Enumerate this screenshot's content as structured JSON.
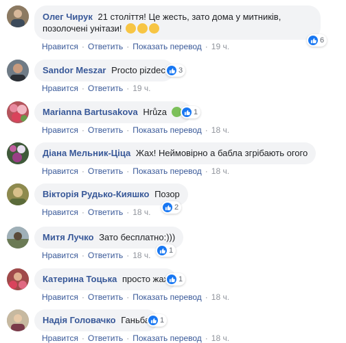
{
  "action_labels": {
    "like": "Нравится",
    "reply": "Ответить",
    "translate": "Показать перевод",
    "separator": "·"
  },
  "colors": {
    "author": "#385898",
    "bubble": "#f2f3f5",
    "meta": "#90949c",
    "like_blue": "#1877f2"
  },
  "comments": [
    {
      "author": "Олег Чирук",
      "text": "21 століття! Це жесть, зато дома у митників, позолочені унітази!",
      "emojis": [
        "frowning-face",
        "frowning-face",
        "frowning-face"
      ],
      "likes": "6",
      "has_translate": true,
      "time": "19 ч."
    },
    {
      "author": "Sandor Meszar",
      "text": "Procto pizdec",
      "likes": "3",
      "has_translate": false,
      "time": "19 ч."
    },
    {
      "author": "Marianna Bartusakova",
      "text": "Hrůza",
      "emojis": [
        "nauseated-face"
      ],
      "likes": "1",
      "has_translate": true,
      "time": "18 ч."
    },
    {
      "author": "Діана Мельник-Ціца",
      "text": "Жах! Неймовірно а бабла згрібають огого",
      "likes": "",
      "has_translate": true,
      "time": "18 ч."
    },
    {
      "author": "Вікторія Рудько-Кияшко",
      "text": "Позор",
      "likes": "2",
      "has_translate": false,
      "time": "18 ч."
    },
    {
      "author": "Митя Лучко",
      "text": "Зато бесплатно:)))",
      "likes": "1",
      "has_translate": false,
      "time": "18 ч."
    },
    {
      "author": "Катерина Тоцька",
      "text": "просто жах",
      "likes": "1",
      "has_translate": true,
      "time": "18 ч."
    },
    {
      "author": "Надія Головачко",
      "text": "Ганьба",
      "likes": "1",
      "has_translate": true,
      "time": "18 ч."
    }
  ]
}
